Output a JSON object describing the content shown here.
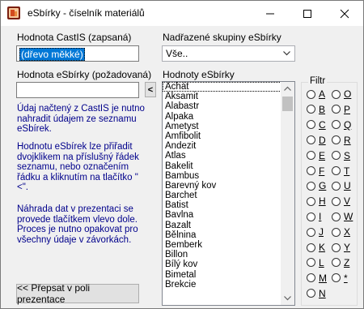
{
  "window": {
    "title": "eSbírky - číselník materiálů"
  },
  "castis": {
    "label": "Hodnota CastIS (zapsaná)",
    "value": "(dřevo měkké)"
  },
  "parent_groups": {
    "label": "Nadřazené skupiny eSbírky",
    "selected": "Vše.."
  },
  "esbirky_value": {
    "label": "Hodnota eSbírky (požadovaná)",
    "value": "",
    "arrow_button": "<"
  },
  "values_list": {
    "label": "Hodnoty eSbírky",
    "items": [
      "Achát",
      "Aksamit",
      "Alabastr",
      "Alpaka",
      "Ametyst",
      "Amfibolit",
      "Andezit",
      "Atlas",
      "Bakelit",
      "Bambus",
      "Barevný kov",
      "Barchet",
      "Batist",
      "Bavlna",
      "Bazalt",
      "Bělnina",
      "Bemberk",
      "Billon",
      "Bílý kov",
      "Bimetal",
      "Brekcie"
    ],
    "selected_index": 0
  },
  "notes": {
    "p1": "Údaj načtený z CastIS je nutno nahradit údajem ze seznamu eSbírek.",
    "p2": "Hodnotu eSbírek lze přiřadit dvojklikem na příslušný řádek seznamu, nebo označením řádku a kliknutím na tlačítko \"<\".",
    "p3": "Náhrada dat v prezentaci se provede tlačítkem vlevo dole. Proces je nutno opakovat pro všechny údaje v závorkách."
  },
  "filter": {
    "label": "Filtr",
    "left": [
      "A",
      "B",
      "C",
      "D",
      "E",
      "F",
      "G",
      "H",
      "I",
      "J",
      "K",
      "L",
      "M",
      "N"
    ],
    "right": [
      "O",
      "P",
      "Q",
      "R",
      "S",
      "T",
      "U",
      "V",
      "W",
      "X",
      "Y",
      "Z",
      "*"
    ]
  },
  "overwrite_button": {
    "label": "<<  Přepsat v poli prezentace"
  },
  "colors": {
    "note_text": "#00008b",
    "selection": "#0078d7"
  }
}
